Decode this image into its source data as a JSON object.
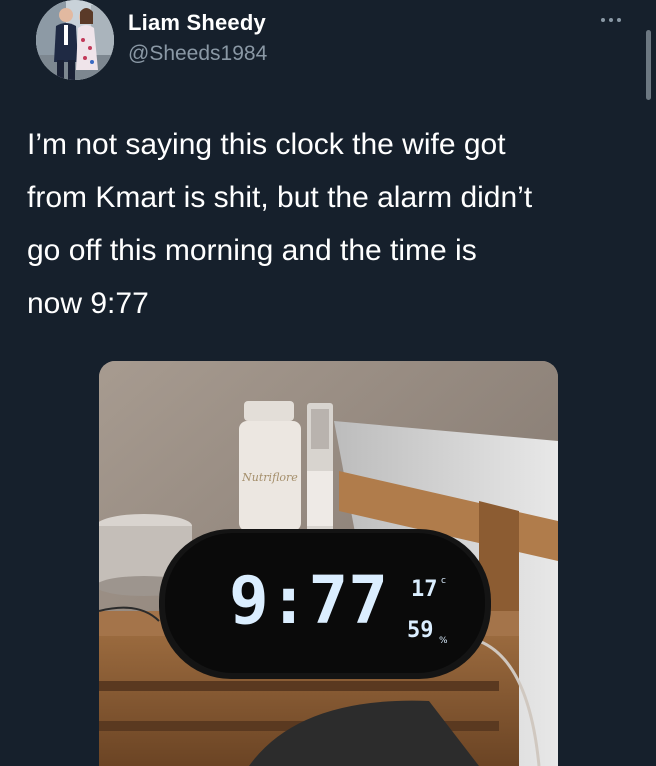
{
  "tweet": {
    "author": {
      "display_name": "Liam Sheedy",
      "handle": "@Sheeds1984"
    },
    "text_lines": [
      "I’m not saying this clock the wife got",
      "from Kmart is shit, but the alarm didn’t",
      "go off this morning and the time is",
      "now 9:77"
    ],
    "media": {
      "clock_time": "9:77",
      "clock_temp": "17",
      "clock_temp_unit": "c",
      "clock_humidity": "59",
      "clock_humidity_unit": "%"
    }
  },
  "icons": {
    "more": "more-horizontal-icon"
  },
  "colors": {
    "background": "#16202c",
    "text_primary": "#ffffff",
    "text_secondary": "#8a98a5",
    "clock_digits": "#dbeeff"
  }
}
